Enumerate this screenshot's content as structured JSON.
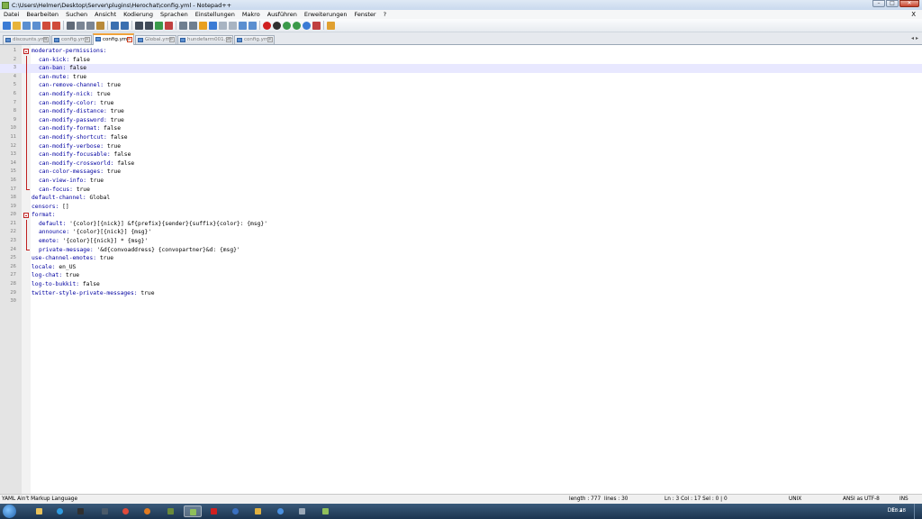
{
  "window": {
    "title": "C:\\Users\\Helmer\\Desktop\\Server\\plugins\\Herochat\\config.yml - Notepad++",
    "min": "–",
    "max": "□",
    "close": "✕"
  },
  "menu": {
    "items": [
      "Datei",
      "Bearbeiten",
      "Suchen",
      "Ansicht",
      "Kodierung",
      "Sprachen",
      "Einstellungen",
      "Makro",
      "Ausführen",
      "Erweiterungen",
      "Fenster",
      "?"
    ],
    "close": "X"
  },
  "toolbar_icons": [
    "new-file-icon",
    "open-file-icon",
    "save-icon",
    "save-all-icon",
    "close-icon",
    "close-all-icon",
    "print-icon",
    "cut-icon",
    "copy-icon",
    "paste-icon",
    "undo-icon",
    "redo-icon",
    "find-icon",
    "replace-icon",
    "zoom-in-icon",
    "zoom-out-icon",
    "sync-v-icon",
    "sync-h-icon",
    "wrap-icon",
    "show-all-icon",
    "indent-guide-icon",
    "lang-icon",
    "doc-map-icon",
    "function-list-icon",
    "record-icon",
    "stop-icon",
    "play-icon",
    "play-multi-icon",
    "save-macro-icon",
    "spellcheck-icon",
    "plugin-icon"
  ],
  "tabs": {
    "items": [
      "discounts.yml",
      "config.yml",
      "config.yml",
      "Global.yml",
      "hundefarm001.yml",
      "config.yml"
    ],
    "active_index": 2,
    "arrows": "◂▸"
  },
  "editor": {
    "current_line": 3,
    "lines": [
      {
        "n": "1",
        "key": "moderator-permissions:",
        "val": "",
        "indent": 0
      },
      {
        "n": "2",
        "key": "can-kick:",
        "val": " false",
        "indent": 2
      },
      {
        "n": "3",
        "key": "can-ban:",
        "val": " false",
        "indent": 2
      },
      {
        "n": "4",
        "key": "can-mute:",
        "val": " true",
        "indent": 2
      },
      {
        "n": "5",
        "key": "can-remove-channel:",
        "val": " true",
        "indent": 2
      },
      {
        "n": "6",
        "key": "can-modify-nick:",
        "val": " true",
        "indent": 2
      },
      {
        "n": "7",
        "key": "can-modify-color:",
        "val": " true",
        "indent": 2
      },
      {
        "n": "8",
        "key": "can-modify-distance:",
        "val": " true",
        "indent": 2
      },
      {
        "n": "9",
        "key": "can-modify-password:",
        "val": " true",
        "indent": 2
      },
      {
        "n": "10",
        "key": "can-modify-format:",
        "val": " false",
        "indent": 2
      },
      {
        "n": "11",
        "key": "can-modify-shortcut:",
        "val": " false",
        "indent": 2
      },
      {
        "n": "12",
        "key": "can-modify-verbose:",
        "val": " true",
        "indent": 2
      },
      {
        "n": "13",
        "key": "can-modify-focusable:",
        "val": " false",
        "indent": 2
      },
      {
        "n": "14",
        "key": "can-modify-crossworld:",
        "val": " false",
        "indent": 2
      },
      {
        "n": "15",
        "key": "can-color-messages:",
        "val": " true",
        "indent": 2
      },
      {
        "n": "16",
        "key": "can-view-info:",
        "val": " true",
        "indent": 2
      },
      {
        "n": "17",
        "key": "can-focus:",
        "val": " true",
        "indent": 2
      },
      {
        "n": "18",
        "key": "default-channel:",
        "val": " Global",
        "indent": 0
      },
      {
        "n": "19",
        "key": "censors:",
        "val": " []",
        "indent": 0
      },
      {
        "n": "20",
        "key": "format:",
        "val": "",
        "indent": 0
      },
      {
        "n": "21",
        "key": "default:",
        "val": " '{color}[{nick}] &f{prefix}{sender}{suffix}{color}: {msg}'",
        "indent": 2
      },
      {
        "n": "22",
        "key": "announce:",
        "val": " '{color}[{nick}] {msg}'",
        "indent": 2
      },
      {
        "n": "23",
        "key": "emote:",
        "val": " '{color}[{nick}] * {msg}'",
        "indent": 2
      },
      {
        "n": "24",
        "key": "private-message:",
        "val": " '&d{convoaddress} {convopartner}&d: {msg}'",
        "indent": 2
      },
      {
        "n": "25",
        "key": "use-channel-emotes:",
        "val": " true",
        "indent": 0
      },
      {
        "n": "26",
        "key": "locale:",
        "val": " en_US",
        "indent": 0
      },
      {
        "n": "27",
        "key": "log-chat:",
        "val": " true",
        "indent": 0
      },
      {
        "n": "28",
        "key": "log-to-bukkit:",
        "val": " false",
        "indent": 0
      },
      {
        "n": "29",
        "key": "twitter-style-private-messages:",
        "val": " true",
        "indent": 0
      },
      {
        "n": "30",
        "key": "",
        "val": "",
        "indent": 0
      }
    ],
    "fold_starts": [
      "1",
      "20"
    ],
    "fold_ends": [
      "17",
      "24"
    ]
  },
  "status": {
    "language": "YAML Ain't Markup Language",
    "length": "length : 777",
    "lines": "lines : 30",
    "position": "Ln : 3    Col : 17    Sel : 0 | 0",
    "eol": "UNIX",
    "encoding": "ANSI as UTF-8",
    "mode": "INS"
  },
  "taskbar": {
    "apps": [
      "explorer-icon",
      "skype-icon",
      "cmd-icon",
      "steam-icon",
      "chrome-icon",
      "firefox-icon",
      "minecraft-icon",
      "notepadpp-icon",
      "acrobat-icon",
      "teamspeak-icon",
      "folder-icon",
      "browser-icon",
      "media-icon",
      "notepadpp-icon-2"
    ],
    "active_index": 7,
    "language": "DE",
    "tray": "▴",
    "clock": "18:38"
  },
  "colors": {
    "key": "#0000a0",
    "current_line": "#e8e8ff",
    "fold_marker": "#c02020",
    "active_tab_accent": "#f0a23a"
  }
}
